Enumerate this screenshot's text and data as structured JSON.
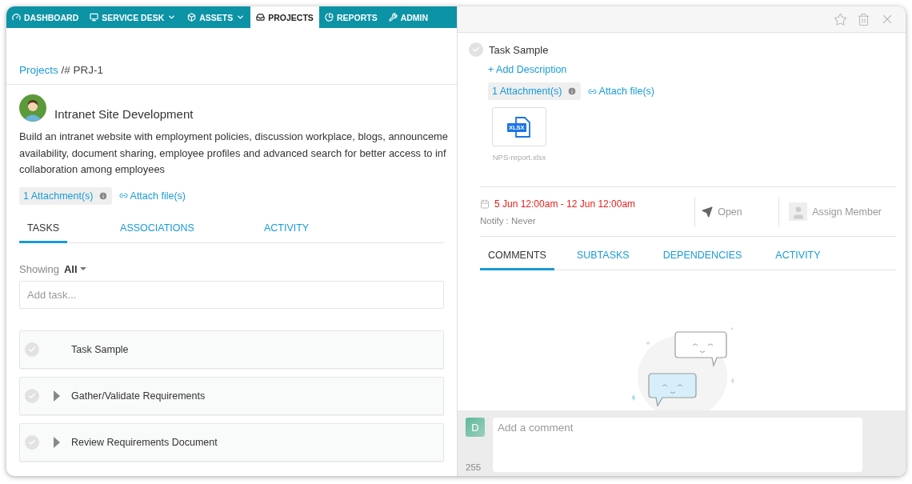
{
  "nav": [
    {
      "label": "DASHBOARD",
      "dropdown": false,
      "selected": false
    },
    {
      "label": "SERVICE DESK",
      "dropdown": true,
      "selected": false
    },
    {
      "label": "ASSETS",
      "dropdown": true,
      "selected": false
    },
    {
      "label": "PROJECTS",
      "dropdown": false,
      "selected": true
    },
    {
      "label": "REPORTS",
      "dropdown": false,
      "selected": false
    },
    {
      "label": "ADMIN",
      "dropdown": false,
      "selected": false
    }
  ],
  "breadcrumb": {
    "link": "Projects",
    "rest": "/# PRJ-1"
  },
  "project": {
    "title": "Intranet Site Development",
    "description_lines": [
      "Build an intranet website with employment policies, discussion workplace, blogs, announceme",
      "availability, document sharing, employee profiles and advanced search for better access to inf",
      "collaboration among employees"
    ],
    "attachments": "1 Attachment(s)",
    "attach_link": "Attach file(s)"
  },
  "tabs": [
    {
      "label": "TASKS",
      "selected": true
    },
    {
      "label": "ASSOCIATIONS",
      "selected": false
    },
    {
      "label": "ACTIVITY",
      "selected": false
    }
  ],
  "filter": {
    "label": "Showing",
    "value": "All"
  },
  "add_task": {
    "placeholder": "Add task..."
  },
  "tasks": [
    {
      "name": "Task Sample",
      "completed": false,
      "expandable": false
    },
    {
      "name": "Gather/Validate Requirements",
      "completed": false,
      "expandable": true
    },
    {
      "name": "Review Requirements Document",
      "completed": false,
      "expandable": true
    }
  ],
  "detail": {
    "title": "Task Sample",
    "completed": false,
    "add_description": "+ Add Description",
    "attachments": "1 Attachment(s)",
    "attach_link": "Attach file(s)",
    "file": {
      "badge": "XLSX",
      "name": "NPS-report.xlsx"
    },
    "dates": "5 Jun 12:00am - 12 Jun 12:00am",
    "notify": "Notify : Never",
    "status": "Open",
    "assign": "Assign Member",
    "tabs": [
      {
        "label": "COMMENTS",
        "selected": true
      },
      {
        "label": "SUBTASKS",
        "selected": false
      },
      {
        "label": "DEPENDENCIES",
        "selected": false
      },
      {
        "label": "ACTIVITY",
        "selected": false
      }
    ],
    "comment": {
      "avatar": "D",
      "placeholder": "Add a comment",
      "counter": "255"
    }
  }
}
